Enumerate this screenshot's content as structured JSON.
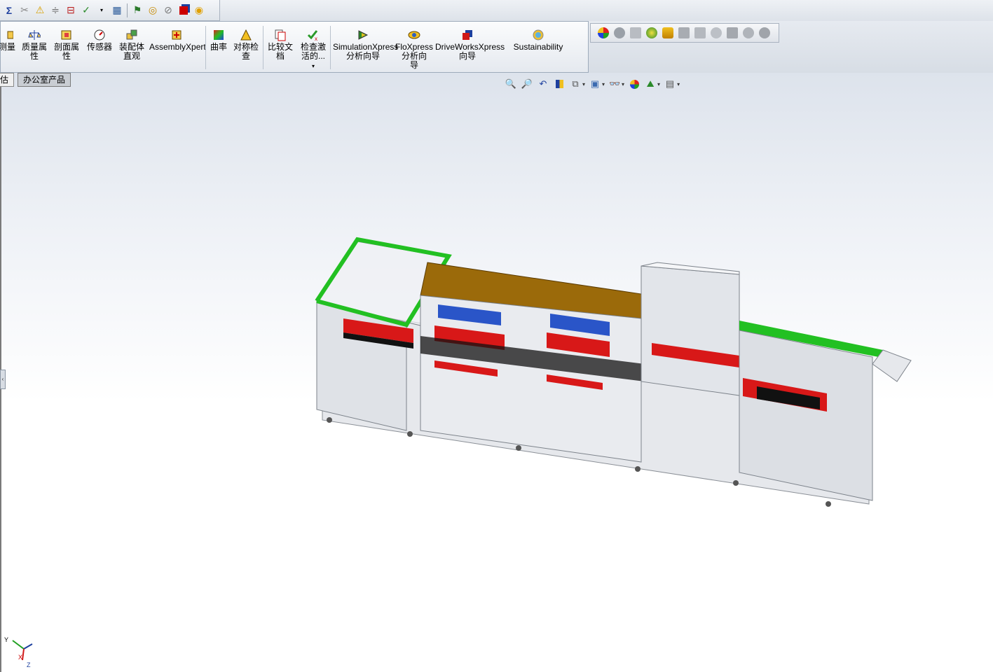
{
  "quick_toolbar": {
    "icons": [
      "sum-icon",
      "scale-icon",
      "warning-icon",
      "split-icon",
      "compare-icon",
      "check-activate-icon",
      "dropdown-caret-icon",
      "table-icon",
      "simulation-icon",
      "floxpress-icon",
      "check-circle-icon",
      "driveworks-icon",
      "sustainability-icon"
    ]
  },
  "command_manager": {
    "items": [
      {
        "id": "measure",
        "label": "测量",
        "icon": "measure-icon"
      },
      {
        "id": "mass-props",
        "label": "质量属\n性",
        "icon": "mass-properties-icon"
      },
      {
        "id": "section-props",
        "label": "剖面属\n性",
        "icon": "section-properties-icon"
      },
      {
        "id": "sensor",
        "label": "传感器",
        "icon": "sensor-icon"
      },
      {
        "id": "assembly-visual",
        "label": "装配体\n直观",
        "icon": "assembly-visualization-icon"
      },
      {
        "id": "assemblyxpert",
        "label": "AssemblyXpert",
        "icon": "assemblyxpert-icon"
      },
      {
        "id": "curvature",
        "label": "曲率",
        "icon": "curvature-icon"
      },
      {
        "id": "symmetry",
        "label": "对称检\n查",
        "icon": "symmetry-check-icon"
      },
      {
        "id": "compare-docs",
        "label": "比较文\n档",
        "icon": "compare-documents-icon"
      },
      {
        "id": "check-active",
        "label": "检查激\n活的...",
        "icon": "check-active-icon"
      },
      {
        "id": "simulationxpress",
        "label": "SimulationXpress\n分析向导",
        "icon": "simulationxpress-icon"
      },
      {
        "id": "floxpress",
        "label": "FloXpress\n分析向\n导",
        "icon": "floxpress-icon"
      },
      {
        "id": "driveworksxpress",
        "label": "DriveWorksXpress\n向导",
        "icon": "driveworksxpress-icon"
      },
      {
        "id": "sustainability",
        "label": "Sustainability",
        "icon": "sustainability-icon"
      }
    ]
  },
  "render_toolbar": {
    "icons": [
      "appearance-icon",
      "decal-icon",
      "scene-icon",
      "lights-icon",
      "cameras-icon",
      "render-icon",
      "preview-icon",
      "final-render-icon",
      "options-icon",
      "schedule-icon",
      "recall-icon"
    ]
  },
  "tabs": {
    "left_fragment": "估",
    "office_products": "办公室产品"
  },
  "view_toolbar": {
    "icons": [
      "zoom-to-fit-icon",
      "zoom-area-icon",
      "previous-view-icon",
      "section-view-icon",
      "view-orientation-icon",
      "display-style-icon",
      "hide-show-icon",
      "edit-appearance-icon",
      "apply-scene-icon",
      "view-settings-icon"
    ]
  },
  "triad": {
    "x_label": "X",
    "y_label": "Y",
    "z_label": "Z"
  },
  "colors": {
    "accent_green": "#22c022",
    "wood_top": "#9b6a0a",
    "frame_gray": "#c9ccd2",
    "conveyor_red": "#d81818"
  }
}
